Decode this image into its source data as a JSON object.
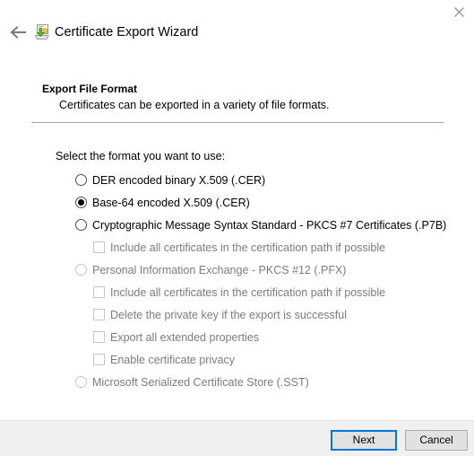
{
  "window": {
    "title": "Certificate Export Wizard",
    "icon": "certificate-export-icon",
    "back_icon": "back-arrow-icon",
    "close_icon": "close-icon"
  },
  "page": {
    "heading": "Export File Format",
    "description": "Certificates can be exported in a variety of file formats.",
    "prompt": "Select the format you want to use:"
  },
  "options": [
    {
      "type": "radio",
      "label": "DER encoded binary X.509 (.CER)",
      "checked": false,
      "disabled": false,
      "name": "option-der-encoded-binary"
    },
    {
      "type": "radio",
      "label": "Base-64 encoded X.509 (.CER)",
      "checked": true,
      "disabled": false,
      "name": "option-base64-encoded"
    },
    {
      "type": "radio",
      "label": "Cryptographic Message Syntax Standard - PKCS #7 Certificates (.P7B)",
      "checked": false,
      "disabled": false,
      "name": "option-pkcs7-certificates"
    },
    {
      "type": "checkbox",
      "label": "Include all certificates in the certification path if possible",
      "checked": false,
      "disabled": true,
      "name": "option-p7b-include-all-certificates"
    },
    {
      "type": "radio",
      "label": "Personal Information Exchange - PKCS #12 (.PFX)",
      "checked": false,
      "disabled": true,
      "name": "option-pkcs12-pfx"
    },
    {
      "type": "checkbox",
      "label": "Include all certificates in the certification path if possible",
      "checked": false,
      "disabled": true,
      "name": "option-pfx-include-all-certificates"
    },
    {
      "type": "checkbox",
      "label": "Delete the private key if the export is successful",
      "checked": false,
      "disabled": true,
      "name": "option-delete-private-key"
    },
    {
      "type": "checkbox",
      "label": "Export all extended properties",
      "checked": false,
      "disabled": true,
      "name": "option-export-extended-properties"
    },
    {
      "type": "checkbox",
      "label": "Enable certificate privacy",
      "checked": false,
      "disabled": true,
      "name": "option-enable-certificate-privacy"
    },
    {
      "type": "radio",
      "label": "Microsoft Serialized Certificate Store (.SST)",
      "checked": false,
      "disabled": true,
      "name": "option-serialized-certificate-store"
    }
  ],
  "footer": {
    "next_label": "Next",
    "cancel_label": "Cancel"
  },
  "colors": {
    "accent": "#0078d7",
    "footer_background": "#f0f0f0",
    "button_face": "#e1e1e1",
    "disabled_text": "#7c7c7c",
    "divider": "#a0a0a0"
  }
}
